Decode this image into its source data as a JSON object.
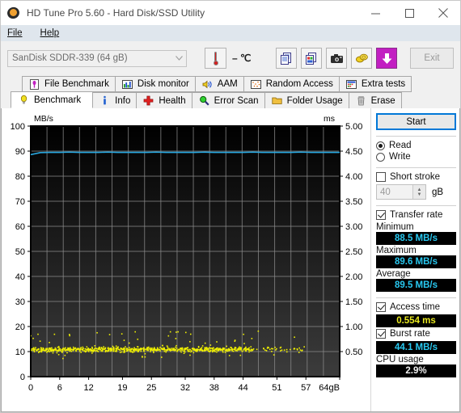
{
  "window": {
    "title": "HD Tune Pro 5.60 - Hard Disk/SSD Utility",
    "icon": "disk-platter-icon",
    "minimize": "─",
    "maximize": "□",
    "close": "✕"
  },
  "menu": {
    "items": [
      {
        "label": "File",
        "accel": "F"
      },
      {
        "label": "Help",
        "accel": "H"
      }
    ]
  },
  "toolbar": {
    "device_combo": {
      "value": "SanDisk  SDDR-339 (64 gB)",
      "arrow": "▾"
    },
    "temperature": {
      "icon": "thermometer-icon",
      "value": "– ℃"
    },
    "buttons": [
      {
        "name": "copy-text-icon",
        "label": ""
      },
      {
        "name": "copy-image-icon",
        "label": ""
      },
      {
        "name": "screenshot-camera-icon",
        "label": ""
      },
      {
        "name": "coins-icon",
        "label": ""
      },
      {
        "name": "download-arrow-icon",
        "label": ""
      }
    ],
    "exit_label": "Exit"
  },
  "tabs": {
    "row1": [
      {
        "label": "File Benchmark",
        "icon": "file-benchmark-icon",
        "active": false
      },
      {
        "label": "Disk monitor",
        "icon": "bar-chart-icon",
        "active": false
      },
      {
        "label": "AAM",
        "icon": "speaker-icon",
        "active": false
      },
      {
        "label": "Random Access",
        "icon": "random-access-icon",
        "active": false
      },
      {
        "label": "Extra tests",
        "icon": "extra-tests-icon",
        "active": false
      }
    ],
    "row2": [
      {
        "label": "Benchmark",
        "icon": "lightbulb-icon",
        "active": true
      },
      {
        "label": "Info",
        "icon": "info-icon",
        "active": false
      },
      {
        "label": "Health",
        "icon": "red-cross-icon",
        "active": false
      },
      {
        "label": "Error Scan",
        "icon": "magnifier-icon",
        "active": false
      },
      {
        "label": "Folder Usage",
        "icon": "folder-icon",
        "active": false
      },
      {
        "label": "Erase",
        "icon": "trash-icon",
        "active": false
      }
    ]
  },
  "panel": {
    "start_label": "Start",
    "mode": {
      "read_label": "Read",
      "write_label": "Write",
      "selected": "Read"
    },
    "short_stroke": {
      "label": "Short stroke",
      "checked": false,
      "value": "40",
      "unit": "gB",
      "spinner_up": "▲",
      "spinner_down": "▼"
    },
    "transfer_rate": {
      "label": "Transfer rate",
      "checked": true,
      "minimum_label": "Minimum",
      "minimum_value": "88.5 MB/s",
      "maximum_label": "Maximum",
      "maximum_value": "89.6 MB/s",
      "average_label": "Average",
      "average_value": "89.5 MB/s"
    },
    "access_time": {
      "label": "Access time",
      "checked": true,
      "value": "0.554 ms"
    },
    "burst_rate": {
      "label": "Burst rate",
      "checked": true,
      "value": "44.1 MB/s"
    },
    "cpu_usage": {
      "label": "CPU usage",
      "value": "2.9%"
    }
  },
  "chart_data": {
    "type": "line",
    "title": "",
    "ylabel": "MB/s",
    "y2label": "ms",
    "xlabel": "",
    "xunit": "gB",
    "xlim": [
      0,
      64
    ],
    "ylim": [
      0,
      100
    ],
    "y2lim": [
      0,
      5.0
    ],
    "grid": true,
    "legend": "none",
    "xticks": [
      0,
      6,
      12,
      19,
      25,
      32,
      38,
      44,
      51,
      57,
      64
    ],
    "xticklabels": [
      "0",
      "6",
      "12",
      "19",
      "25",
      "32",
      "38",
      "44",
      "51",
      "57",
      "64gB"
    ],
    "yticks": [
      0,
      10,
      20,
      30,
      40,
      50,
      60,
      70,
      80,
      90,
      100
    ],
    "yticklabels": [
      "0",
      "10",
      "20",
      "30",
      "40",
      "50",
      "60",
      "70",
      "80",
      "90",
      "100"
    ],
    "y2ticks": [
      0.5,
      1.0,
      1.5,
      2.0,
      2.5,
      3.0,
      3.5,
      4.0,
      4.5,
      5.0
    ],
    "y2ticklabels": [
      "0.50",
      "1.00",
      "1.50",
      "2.00",
      "2.50",
      "3.00",
      "3.50",
      "4.00",
      "4.50",
      "5.00"
    ],
    "plot_bg_top": "#000000",
    "plot_bg_bottom": "#3c3c3c",
    "grid_color": "#8c8c8c",
    "series": [
      {
        "name": "transfer rate",
        "axis": "left",
        "type": "line",
        "color": "#29a8e0",
        "x": [
          0,
          2,
          4,
          6,
          8,
          10,
          12,
          14,
          16,
          18,
          20,
          22,
          24,
          26,
          28,
          30,
          32,
          34,
          36,
          38,
          40,
          42,
          44,
          46,
          48,
          50,
          52,
          54,
          56,
          58,
          60,
          62,
          64
        ],
        "y": [
          88.6,
          89.4,
          89.5,
          89.5,
          89.6,
          89.5,
          89.5,
          89.5,
          89.6,
          89.5,
          89.5,
          89.5,
          89.5,
          89.6,
          89.5,
          89.5,
          89.5,
          89.5,
          89.6,
          89.5,
          89.5,
          89.5,
          89.5,
          89.6,
          89.5,
          89.5,
          89.5,
          89.5,
          89.6,
          89.5,
          89.5,
          89.5,
          89.5
        ]
      },
      {
        "name": "access time",
        "axis": "right",
        "type": "scatter",
        "color": "#f0f000",
        "mean_ms": 0.554,
        "spread_ms": [
          0.35,
          0.95
        ],
        "point_count": 900,
        "x_range": [
          0,
          57
        ]
      }
    ]
  }
}
